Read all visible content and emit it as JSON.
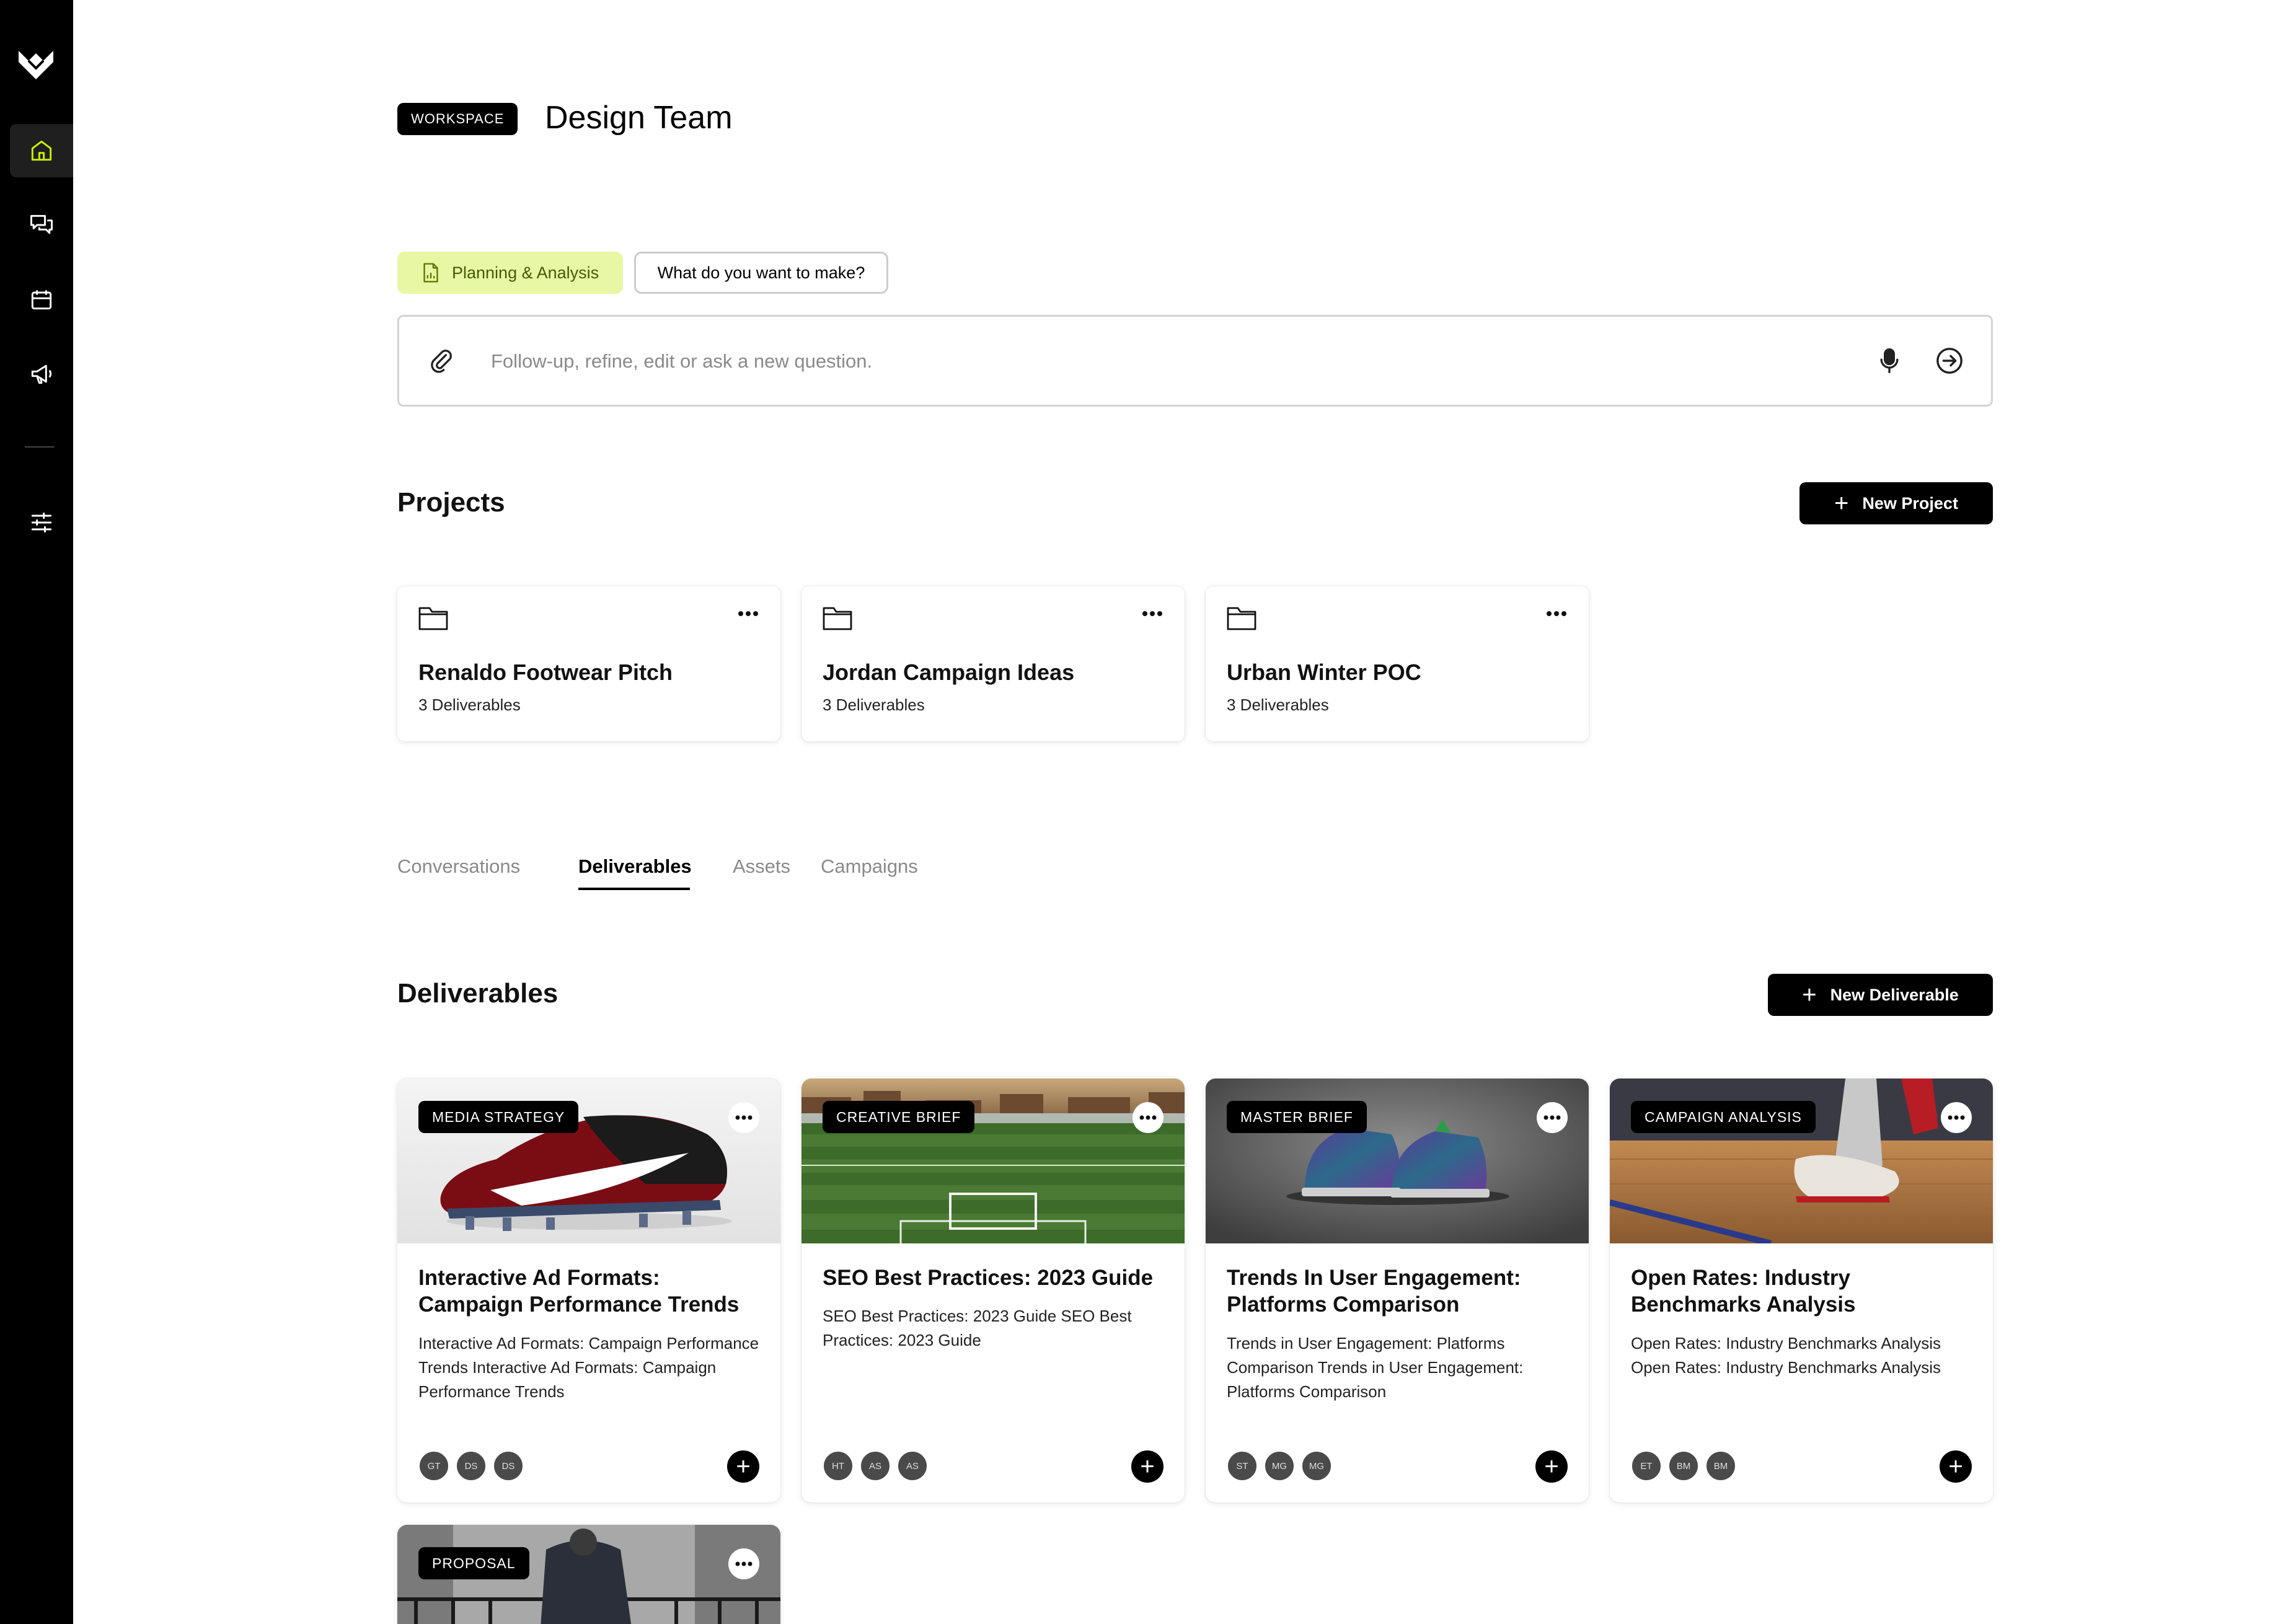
{
  "sidebar": {
    "logo": "brand-logo",
    "items": [
      {
        "name": "home-icon",
        "active": true
      },
      {
        "name": "chat-icon",
        "active": false
      },
      {
        "name": "calendar-icon",
        "active": false
      },
      {
        "name": "megaphone-icon",
        "active": false
      },
      {
        "name": "sliders-icon",
        "active": false
      }
    ]
  },
  "workspace": {
    "badge": "WORKSPACE",
    "title": "Design Team"
  },
  "chips": {
    "planning": "Planning & Analysis",
    "make": "What do you want to make?"
  },
  "prompt": {
    "placeholder": "Follow-up, refine, edit or ask a new question."
  },
  "projects": {
    "title": "Projects",
    "new_label": "New Project",
    "items": [
      {
        "name": "Renaldo Footwear Pitch",
        "count": "3 Deliverables"
      },
      {
        "name": "Jordan Campaign Ideas",
        "count": "3 Deliverables"
      },
      {
        "name": "Urban Winter POC",
        "count": "3 Deliverables"
      }
    ]
  },
  "tabs": [
    {
      "label": "Conversations",
      "active": false
    },
    {
      "label": "Deliverables",
      "active": true
    },
    {
      "label": "Assets",
      "active": false
    },
    {
      "label": "Campaigns",
      "active": false
    }
  ],
  "deliverables": {
    "title": "Deliverables",
    "new_label": "New Deliverable",
    "items": [
      {
        "tag": "MEDIA STRATEGY",
        "title": "Interactive Ad Formats: Campaign Performance Trends",
        "desc": "Interactive Ad Formats: Campaign Performance Trends Interactive Ad Formats: Campaign Performance Trends",
        "avatars": [
          "GT",
          "DS",
          "DS"
        ]
      },
      {
        "tag": "CREATIVE BRIEF",
        "title": "SEO Best Practices: 2023 Guide",
        "desc": "SEO Best Practices: 2023 Guide SEO Best Practices: 2023 Guide",
        "avatars": [
          "HT",
          "AS",
          "AS"
        ]
      },
      {
        "tag": "MASTER BRIEF",
        "title": "Trends In User Engagement: Platforms Comparison",
        "desc": "Trends in User Engagement: Platforms Comparison Trends in User Engagement: Platforms Comparison",
        "avatars": [
          "ST",
          "MG",
          "MG"
        ]
      },
      {
        "tag": "CAMPAIGN ANALYSIS",
        "title": "Open Rates: Industry Benchmarks Analysis",
        "desc": "Open Rates: Industry Benchmarks Analysis Open Rates: Industry Benchmarks Analysis",
        "avatars": [
          "ET",
          "BM",
          "BM"
        ]
      },
      {
        "tag": "PROPOSAL"
      }
    ]
  },
  "colors": {
    "accent_green": "#c8f000",
    "chip_bg": "#e8f7a4"
  }
}
